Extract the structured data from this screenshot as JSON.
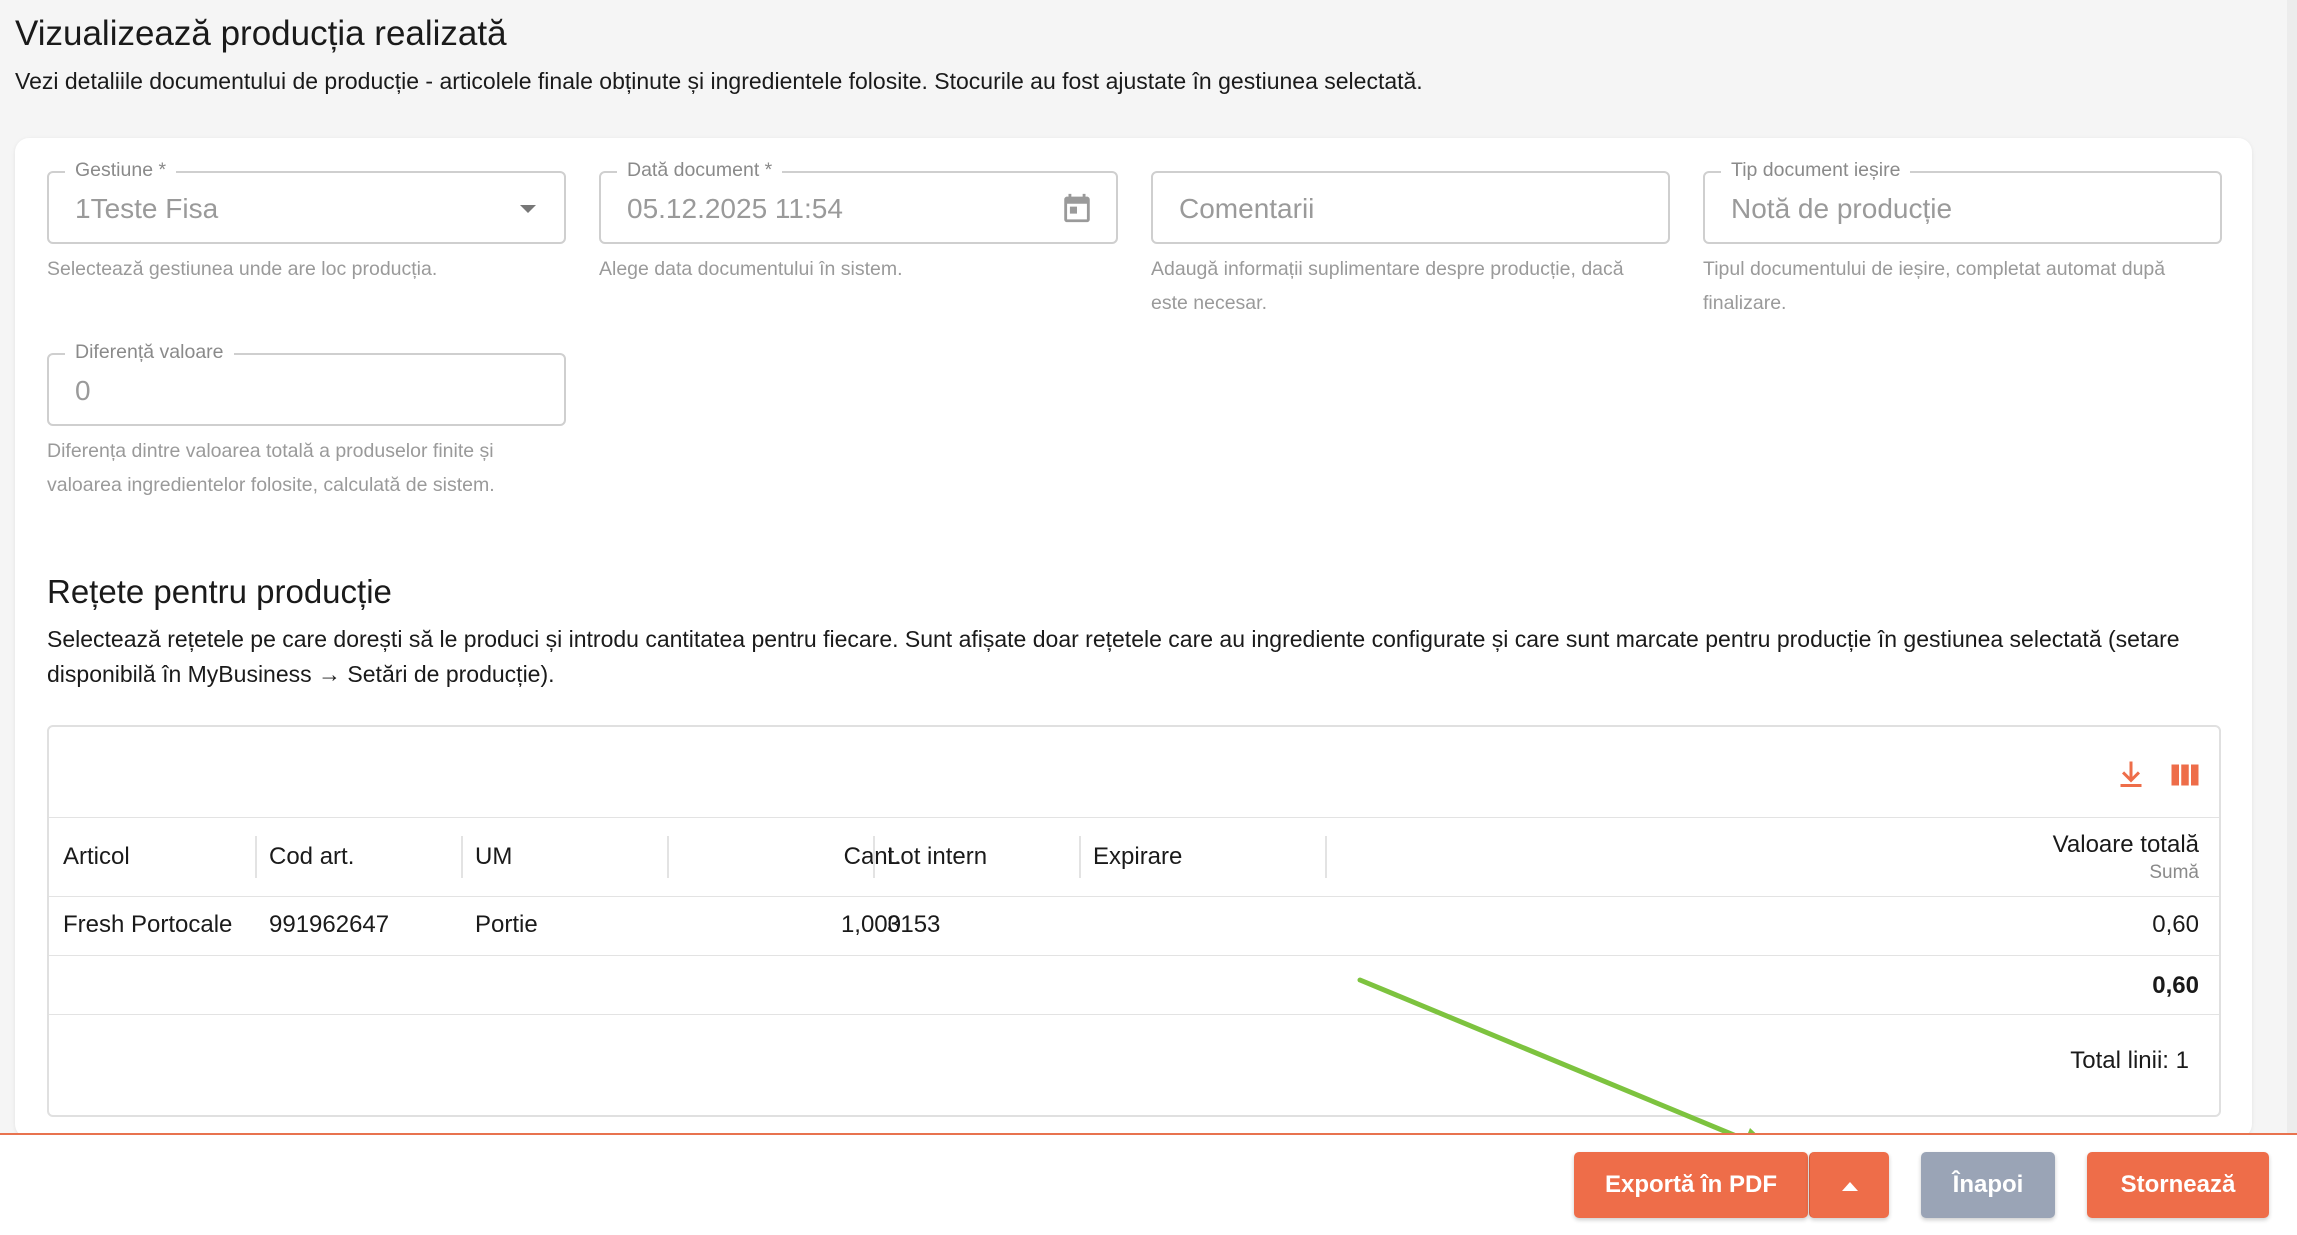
{
  "header": {
    "title": "Vizualizează producția realizată",
    "description": "Vezi detaliile documentului de producție - articolele finale obținute și ingredientele folosite. Stocurile au fost ajustate în gestiunea selectată."
  },
  "form": {
    "gestiune": {
      "label": "Gestiune *",
      "value": "1Teste Fisa",
      "helper": "Selectează gestiunea unde are loc producția."
    },
    "data_document": {
      "label": "Dată document *",
      "value": "05.12.2025 11:54",
      "helper": "Alege data documentului în sistem."
    },
    "comentarii": {
      "placeholder": "Comentarii",
      "helper": "Adaugă informații suplimentare despre producție, dacă este necesar."
    },
    "tip_document": {
      "label": "Tip document ieșire",
      "value": "Notă de producție",
      "helper": "Tipul documentului de ieșire, completat automat după finalizare."
    },
    "diferenta_valoare": {
      "label": "Diferență valoare",
      "value": "0",
      "helper": "Diferența dintre valoarea totală a produselor finite și valoarea ingredientelor folosite, calculată de sistem."
    }
  },
  "recipes": {
    "title": "Rețete pentru producție",
    "description": "Selectează rețetele pe care dorești să le produci și introdu cantitatea pentru fiecare. Sunt afișate doar rețetele care au ingrediente configurate și care sunt marcate pentru producție în gestiunea selectată (setare disponibilă în MyBusiness → Setări de producție).",
    "columns": [
      "Articol",
      "Cod art.",
      "UM",
      "Cant.",
      "Lot intern",
      "Expirare",
      "Valoare totală"
    ],
    "valoare_sub": "Sumă",
    "rows": [
      {
        "articol": "Fresh Portocale",
        "cod": "991962647",
        "um": "Portie",
        "cant": "1,000",
        "lot": "3153",
        "expirare": "",
        "valoare": "0,60"
      }
    ],
    "total_value": "0,60",
    "total_lines": "Total linii: 1"
  },
  "icons": {
    "download": "download-icon",
    "columns": "columns-icon",
    "calendar": "calendar-icon",
    "dropdown": "chevron-down-icon",
    "menu": "caret-up-icon"
  },
  "footer": {
    "export_label": "Exportă în PDF",
    "back_label": "Înapoi",
    "reverse_label": "Stornează"
  },
  "colors": {
    "accent": "#ee6d49",
    "secondary": "#9aa4b6",
    "annotation_arrow": "#7dc33f"
  }
}
